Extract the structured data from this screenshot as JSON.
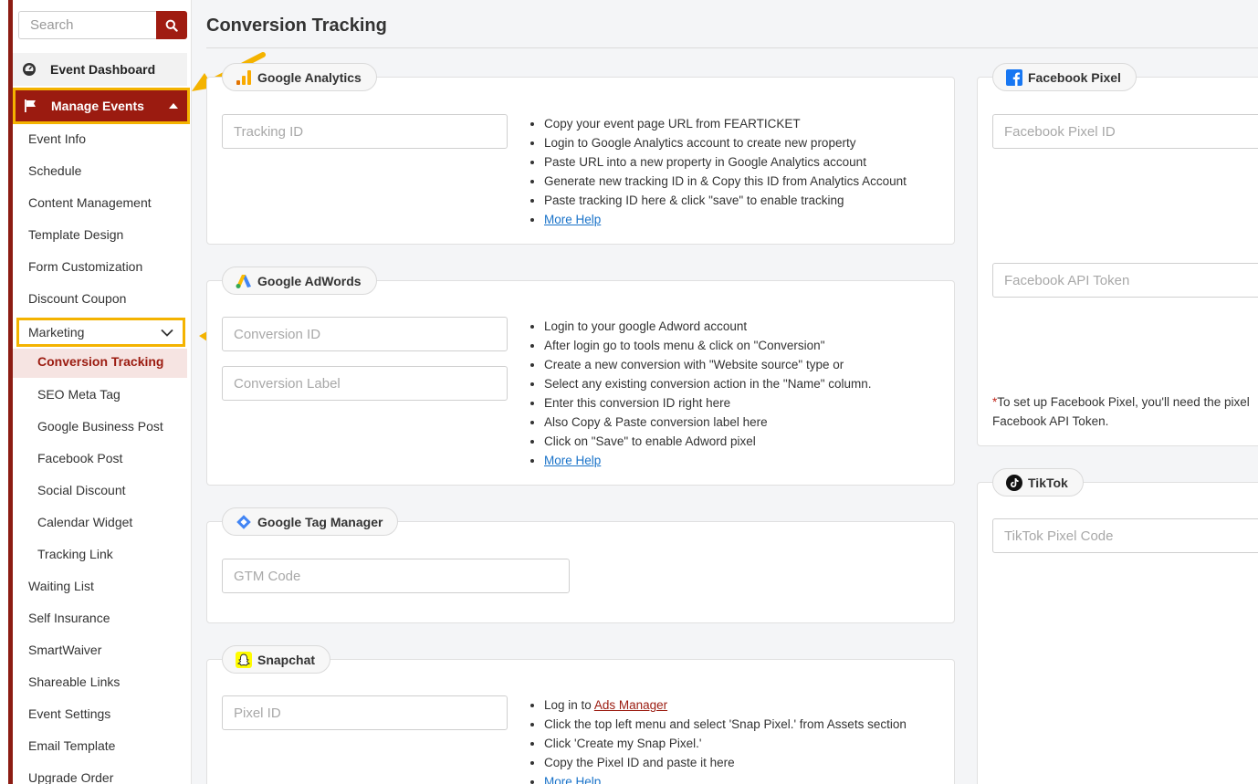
{
  "sidebar": {
    "search_placeholder": "Search",
    "event_dashboard": "Event Dashboard",
    "manage_events": "Manage Events",
    "items_top": [
      "Event Info",
      "Schedule",
      "Content Management",
      "Template Design",
      "Form Customization",
      "Discount Coupon"
    ],
    "marketing": "Marketing",
    "active_sub": "Conversion Tracking",
    "marketing_sub": [
      "SEO Meta Tag",
      "Google Business Post",
      "Facebook Post",
      "Social Discount",
      "Calendar Widget",
      "Tracking Link"
    ],
    "items_bottom": [
      "Waiting List",
      "Self Insurance",
      "SmartWaiver",
      "Shareable Links",
      "Event Settings",
      "Email Template",
      "Upgrade Order"
    ]
  },
  "main": {
    "title": "Conversion Tracking",
    "google_analytics": {
      "label": "Google Analytics",
      "placeholder": "Tracking ID",
      "help": [
        "Copy your event page URL from FEARTICKET",
        "Login to Google Analytics account to create new property",
        "Paste URL into a new property in Google Analytics account",
        "Generate new tracking ID in & Copy this ID from Analytics Account",
        "Paste tracking ID here & click \"save\" to enable tracking"
      ],
      "more_help": "More Help"
    },
    "google_adwords": {
      "label": "Google AdWords",
      "placeholder_id": "Conversion ID",
      "placeholder_label": "Conversion Label",
      "help": [
        "Login to your google Adword account",
        "After login go to tools menu & click on \"Conversion\"",
        "Create a new conversion with \"Website source\" type or",
        "Select any existing conversion action in the \"Name\" column.",
        "Enter this conversion ID right here",
        "Also Copy & Paste conversion label here",
        "Click on \"Save\" to enable Adword pixel"
      ],
      "more_help": "More Help"
    },
    "gtm": {
      "label": "Google Tag Manager",
      "placeholder": "GTM Code"
    },
    "snapchat": {
      "label": "Snapchat",
      "placeholder": "Pixel ID",
      "help_login_prefix": "Log in to ",
      "help_login_link": "Ads Manager",
      "help": [
        "Click the top left menu and select 'Snap Pixel.' from Assets section",
        "Click 'Create my Snap Pixel.'",
        "Copy the Pixel ID and paste it here"
      ],
      "more_help": "More Help"
    },
    "facebook": {
      "label": "Facebook Pixel",
      "placeholder_pixel": "Facebook Pixel ID",
      "placeholder_token": "Facebook API Token",
      "note_star": "*",
      "note_line1": "To set up Facebook Pixel, you'll need the pixel",
      "note_line2": "Facebook API Token."
    },
    "tiktok": {
      "label": "TikTok",
      "placeholder": "TikTok Pixel Code"
    }
  },
  "colors": {
    "brand": "#9b1b10",
    "highlight": "#f4b300",
    "link": "#1a73c9"
  }
}
